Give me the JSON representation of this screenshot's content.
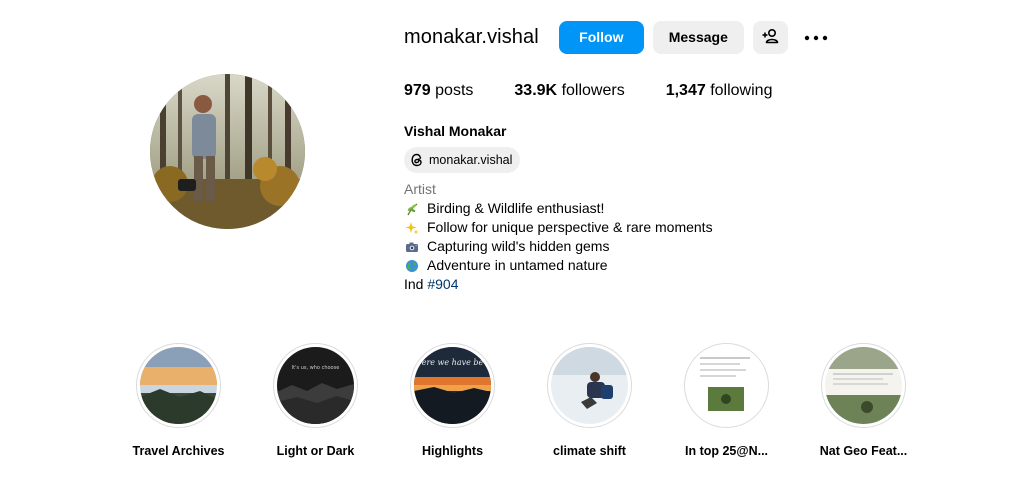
{
  "profile": {
    "username": "monakar.vishal",
    "follow_label": "Follow",
    "message_label": "Message",
    "stats": {
      "posts_count": "979",
      "posts_label": "posts",
      "followers_count": "33.9K",
      "followers_label": "followers",
      "following_count": "1,347",
      "following_label": "following"
    },
    "full_name": "Vishal Monakar",
    "threads_handle": "monakar.vishal",
    "category": "Artist",
    "bio_lines": [
      {
        "icon": "herb-icon",
        "text": "Birding & Wildlife enthusiast!"
      },
      {
        "icon": "sparkles-icon",
        "text": "Follow for unique perspective & rare moments"
      },
      {
        "icon": "camera-icon",
        "text": "Capturing wild's hidden gems"
      },
      {
        "icon": "globe-icon",
        "text": "Adventure in untamed nature"
      }
    ],
    "location_text": "Ind",
    "hashtag": "#904"
  },
  "highlights": [
    {
      "label": "Travel Archives"
    },
    {
      "label": "Light or Dark",
      "cover_text": "It's us, who choose"
    },
    {
      "label": "Highlights",
      "cover_text": "ere we have be"
    },
    {
      "label": "climate shift"
    },
    {
      "label": "In top 25@N..."
    },
    {
      "label": "Nat Geo Feat..."
    }
  ],
  "colors": {
    "primary_blue": "#0095f6",
    "button_gray": "#efefef",
    "hashtag": "#00376b",
    "muted_text": "#737373"
  }
}
